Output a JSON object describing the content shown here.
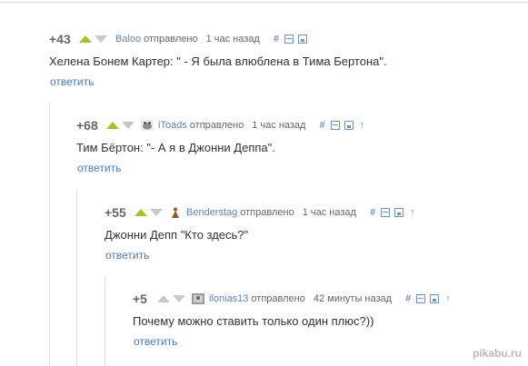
{
  "comments": [
    {
      "rating": "+43",
      "author": "Baloo",
      "posted": "отправлено",
      "time": "1 час назад",
      "text": "Хелена Бонем Картер: \" - Я была влюблена в Тима Бертона\".",
      "reply": "ответить",
      "upvoted": true,
      "avatar": "none"
    },
    {
      "rating": "+68",
      "author": "iToads",
      "posted": "отправлено",
      "time": "1 час назад",
      "text": "Тим Бёртон: \"- А я в Джонни Деппа\".",
      "reply": "ответить",
      "upvoted": true,
      "avatar": "toad-avatar-icon"
    },
    {
      "rating": "+55",
      "author": "Benderstag",
      "posted": "отправлено",
      "time": "1 час назад",
      "text": "Джонни Депп \"Кто здесь?\"",
      "reply": "ответить",
      "upvoted": true,
      "avatar": "figure-avatar-icon"
    },
    {
      "rating": "+5",
      "author": "ilonias13",
      "posted": "отправлено",
      "time": "42 минуты назад",
      "text": "Почему можно ставить только один плюс?))",
      "reply": "ответить",
      "upvoted": false,
      "avatar": "photo-avatar-icon"
    }
  ],
  "icons": {
    "hash": "#",
    "parent": "↑"
  },
  "watermark": "pikabu.ru",
  "colors": {
    "upvote": "#9ac91f",
    "link": "#5f83b5",
    "muted": "#c8c8c8"
  }
}
